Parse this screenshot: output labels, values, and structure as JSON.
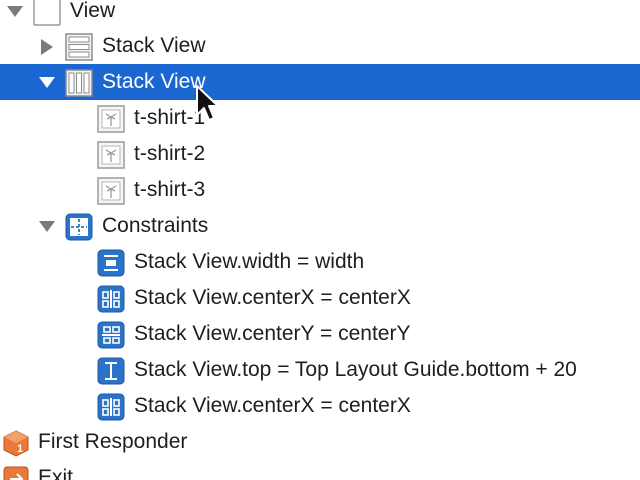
{
  "outline": {
    "rows": [
      {
        "label": "View",
        "disclosure": "expanded",
        "icon": "view-icon"
      },
      {
        "label": "Stack View",
        "disclosure": "collapsed",
        "icon": "vertical-stack-view-icon"
      },
      {
        "label": "Stack View",
        "disclosure": "expanded",
        "icon": "horizontal-stack-view-icon",
        "selected": true
      },
      {
        "label": "t-shirt-1",
        "icon": "image-view-icon"
      },
      {
        "label": "t-shirt-2",
        "icon": "image-view-icon"
      },
      {
        "label": "t-shirt-3",
        "icon": "image-view-icon"
      },
      {
        "label": "Constraints",
        "disclosure": "expanded",
        "icon": "constraints-icon"
      },
      {
        "label": "Stack View.width = width",
        "icon": "width-constraint-icon"
      },
      {
        "label": "Stack View.centerX = centerX",
        "icon": "center-x-constraint-icon"
      },
      {
        "label": "Stack View.centerY = centerY",
        "icon": "center-y-constraint-icon"
      },
      {
        "label": "Stack View.top = Top Layout Guide.bottom + 20",
        "icon": "top-constraint-icon"
      },
      {
        "label": "Stack View.centerX = centerX",
        "icon": "center-x-constraint-icon"
      },
      {
        "label": "First Responder",
        "icon": "first-responder-icon"
      },
      {
        "label": "Exit",
        "icon": "exit-icon"
      }
    ]
  },
  "colors": {
    "selection": "#1a67d2",
    "constraint_blue": "#2b73c8",
    "disclosure_gray": "#7a7a7a",
    "responder_orange": "#e8793a"
  },
  "cursor": {
    "icon": "arrow-cursor-icon"
  }
}
